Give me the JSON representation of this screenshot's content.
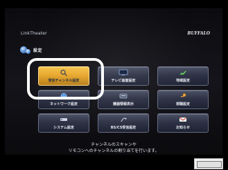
{
  "header": {
    "brand": "LinkTheater",
    "maker": "BUFFALO",
    "title": "設定"
  },
  "menu": {
    "items": [
      {
        "label": "受信チャンネル設定",
        "icon": "search-icon",
        "selected": true
      },
      {
        "label": "テレビ画面設定",
        "icon": "tv-icon",
        "selected": false
      },
      {
        "label": "地域設定",
        "icon": "map-icon",
        "selected": false
      },
      {
        "label": "ネットワーク設定",
        "icon": "globe-icon",
        "selected": false
      },
      {
        "label": "機器情報表示",
        "icon": "info-icon",
        "selected": false
      },
      {
        "label": "視聴設定",
        "icon": "key-icon",
        "selected": false
      },
      {
        "label": "システム設定",
        "icon": "remote-icon",
        "selected": false
      },
      {
        "label": "BS/CS受信設定",
        "icon": "satellite-icon",
        "selected": false
      },
      {
        "label": "お知らせ",
        "icon": "mail-icon",
        "selected": false
      }
    ]
  },
  "description": {
    "line1": "チャンネルのスキャンや",
    "line2": "リモコンへのチャンネルの割り当てを行います。"
  },
  "colors": {
    "background": "#000000",
    "tile": "#2d3245",
    "tile_selected": "#e8a72c",
    "ring": "#ffffff"
  }
}
